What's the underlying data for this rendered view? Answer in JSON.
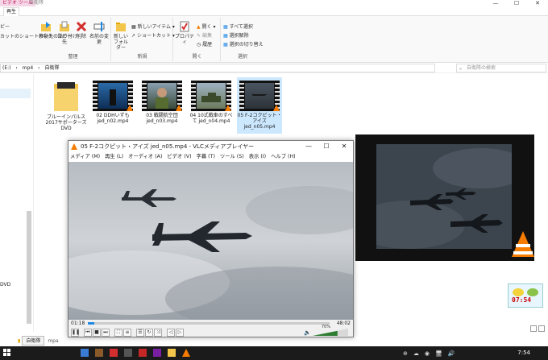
{
  "explorer": {
    "context_tab": "ビデオ ツール",
    "title": "自衛隊",
    "ribbon_tab": "再生",
    "window_controls": {
      "minimize": "—",
      "maximize": "☐",
      "close": "✕"
    },
    "left_cut_items": [
      "ビー",
      "カットのショートカットの貼り付け"
    ],
    "groups": {
      "organize": {
        "label": "整理",
        "buttons": [
          "移動先",
          "コピー先",
          "削除",
          "名前の変更"
        ]
      },
      "new": {
        "label": "新規",
        "big_button": "新しいフォルダー",
        "small_buttons": [
          "新しいアイテム ▾",
          "ショートカット ▾"
        ]
      },
      "open": {
        "label": "開く",
        "big_button": "プロパティ",
        "small_buttons": [
          "開く ▾",
          "編集",
          "履歴"
        ]
      },
      "select": {
        "label": "選択",
        "small_buttons": [
          "すべて選択",
          "選択解除",
          "選択の切り替え"
        ]
      }
    },
    "address": [
      "(E:)",
      "›",
      "mp4",
      "›",
      "自衛隊"
    ],
    "search_placeholder": "自衛隊の検索",
    "nav_dvd": "DVD",
    "files": [
      {
        "name": "ブルーインパルス2017サポーターズDVD",
        "kind": "folder"
      },
      {
        "name": "02 DDHいずも jed_n02.mp4",
        "kind": "video"
      },
      {
        "name": "03 戦闘航空団 jed_n03.mp4",
        "kind": "video"
      },
      {
        "name": "04 10式戦車のすべて jed_n04.mp4",
        "kind": "video"
      },
      {
        "name": "05 F-2コクピット・アイズ jed_n05.mp4",
        "kind": "video",
        "selected": true
      }
    ],
    "open_folder_tab": "自衛隊",
    "open_folder_prefix": "mpa"
  },
  "vlc": {
    "title": "05 F-2コクピット・アイズ jed_n05.mp4 - VLCメディアプレイヤー",
    "menu": [
      "メディア (M)",
      "再生 (L)",
      "オーディオ (A)",
      "ビデオ (V)",
      "字幕 (T)",
      "ツール (S)",
      "表示 (I)",
      "ヘルプ (H)"
    ],
    "elapsed": "01:18",
    "duration": "48:02",
    "progress": 0.027,
    "volume_percent": "70%",
    "volume_level": 0.7
  },
  "widget": {
    "time": "07:54"
  },
  "taskbar": {
    "time": "7:54",
    "tray_items": [
      "⊕",
      "☁",
      "◉",
      "🖥",
      "🔊"
    ]
  },
  "colors": {
    "accent": "#1e88e5",
    "vlc_orange": "#f57c00",
    "taskbar": "#1b1b1b"
  }
}
